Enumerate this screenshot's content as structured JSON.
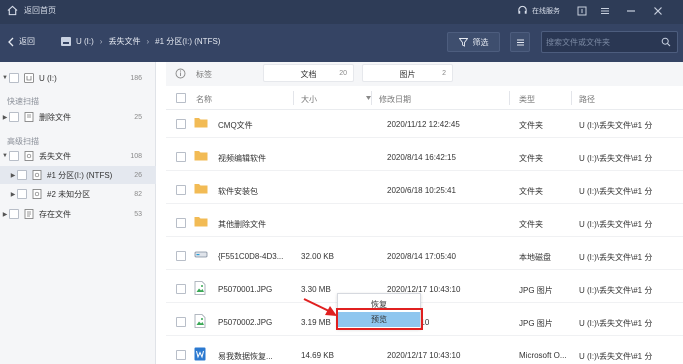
{
  "titlebar": {
    "home_label": "返回首页",
    "service_label": "在线服务"
  },
  "navbar": {
    "back_label": "返回",
    "breadcrumb": [
      "U (I:)",
      "丢失文件",
      "#1 分区(I:) (NTFS)"
    ],
    "filter_label": "筛选",
    "search_placeholder": "搜索文件或文件夹"
  },
  "sidebar": {
    "root": {
      "label": "U (I:)",
      "count": "186"
    },
    "quick_scan_label": "快速扫描",
    "deleted": {
      "label": "删除文件",
      "count": "25"
    },
    "advanced_scan_label": "高级扫描",
    "lost": {
      "label": "丢失文件",
      "count": "108"
    },
    "part1": {
      "label": "#1 分区(I:) (NTFS)",
      "count": "26"
    },
    "part2": {
      "label": "#2 未知分区",
      "count": "82"
    },
    "existing": {
      "label": "存在文件",
      "count": "53"
    }
  },
  "tabs": {
    "label": "标签",
    "docs": {
      "label": "文档",
      "count": "20"
    },
    "images": {
      "label": "图片",
      "count": "2"
    }
  },
  "table": {
    "headers": {
      "name": "名称",
      "size": "大小",
      "modified": "修改日期",
      "type": "类型",
      "path": "路径"
    },
    "rows": [
      {
        "name": "CMQ文件",
        "size": "",
        "date": "2020/11/12 12:42:45",
        "type": "文件夹",
        "path": "U (I:)\\丢失文件\\#1 分",
        "icon": "folder-icon"
      },
      {
        "name": "视频编辑软件",
        "size": "",
        "date": "2020/8/14 16:42:15",
        "type": "文件夹",
        "path": "U (I:)\\丢失文件\\#1 分",
        "icon": "folder-icon"
      },
      {
        "name": "软件安装包",
        "size": "",
        "date": "2020/6/18 10:25:41",
        "type": "文件夹",
        "path": "U (I:)\\丢失文件\\#1 分",
        "icon": "folder-icon"
      },
      {
        "name": "其他删除文件",
        "size": "",
        "date": "",
        "type": "文件夹",
        "path": "U (I:)\\丢失文件\\#1 分",
        "icon": "folder-icon"
      },
      {
        "name": "{F551C0D8-4D3...",
        "size": "32.00 KB",
        "date": "2020/8/14 17:05:40",
        "type": "本地磁盘",
        "path": "U (I:)\\丢失文件\\#1 分",
        "icon": "disk-icon"
      },
      {
        "name": "P5070001.JPG",
        "size": "3.30 MB",
        "date": "2020/12/17 10:43:10",
        "type": "JPG 图片",
        "path": "U (I:)\\丢失文件\\#1 分",
        "icon": "jpg-icon"
      },
      {
        "name": "P5070002.JPG",
        "size": "3.19 MB",
        "date": "17 10:43:10",
        "type": "JPG 图片",
        "path": "U (I:)\\丢失文件\\#1 分",
        "icon": "jpg-icon"
      },
      {
        "name": "易我数据恢复...",
        "size": "14.69 KB",
        "date": "2020/12/17 10:43:10",
        "type": "Microsoft O...",
        "path": "U (I:)\\丢失文件\\#1 分",
        "icon": "word-icon"
      }
    ]
  },
  "context_menu": {
    "restore_label": "恢复",
    "preview_label": "预览"
  },
  "colors": {
    "titlebar": "#2e3c57",
    "navbar": "#354464",
    "folder": "#f2bb55",
    "highlight": "#8fc6ef",
    "annotation": "#e02020"
  }
}
